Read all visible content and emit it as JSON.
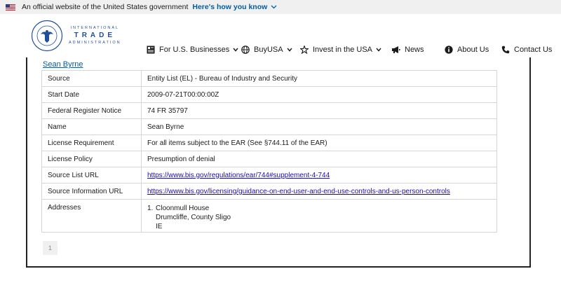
{
  "gov_banner": {
    "text": "An official website of the United States government",
    "link_label": "Here's how you know"
  },
  "logo": {
    "line1": "INTERNATIONAL",
    "line2": "TRADE",
    "line3": "ADMINISTRATION",
    "seal_text": "DEPARTMENT OF COMMERCE · UNITED STATES OF AMERICA"
  },
  "nav": {
    "items": [
      {
        "label": "For U.S. Businesses",
        "icon": "businesses-icon",
        "dropdown": true
      },
      {
        "label": "BuyUSA",
        "icon": "globe-icon",
        "dropdown": true
      },
      {
        "label": "Invest in the USA",
        "icon": "star-icon",
        "dropdown": true
      },
      {
        "label": "News",
        "icon": "megaphone-icon",
        "dropdown": false
      },
      {
        "label": "About Us",
        "icon": "info-icon",
        "dropdown": false
      },
      {
        "label": "Contact Us",
        "icon": "phone-icon",
        "dropdown": false
      }
    ]
  },
  "record": {
    "name": "Sean Byrne",
    "rows": [
      {
        "label": "Source",
        "value": "Entity List (EL) - Bureau of Industry and Security"
      },
      {
        "label": "Start Date",
        "value": "2009-07-21T00:00:00Z"
      },
      {
        "label": "Federal Register Notice",
        "value": "74 FR 35797"
      },
      {
        "label": "Name",
        "value": "Sean Byrne"
      },
      {
        "label": "License Requirement",
        "value": "For all items subject to the EAR (See §744.11 of the EAR)"
      },
      {
        "label": "License Policy",
        "value": "Presumption of denial"
      },
      {
        "label": "Source List URL",
        "value": "https://www.bis.gov/regulations/ear/744#supplement-4-744"
      },
      {
        "label": "Source Information URL",
        "value": "https://www.bis.gov/licensing/guidance-on-end-user-and-end-use-controls-and-us-person-controls"
      },
      {
        "label": "Addresses"
      }
    ],
    "address": {
      "number": "1.",
      "line1": "Cloonmull House",
      "line2": "Drumcliffe, County Sligo",
      "line3": "IE"
    }
  },
  "pagination": {
    "current": "1"
  },
  "colors": {
    "link": "#005ea2",
    "url_link": "#1a0dab",
    "brand": "#1f4f9a",
    "border": "#d6d6d6"
  }
}
